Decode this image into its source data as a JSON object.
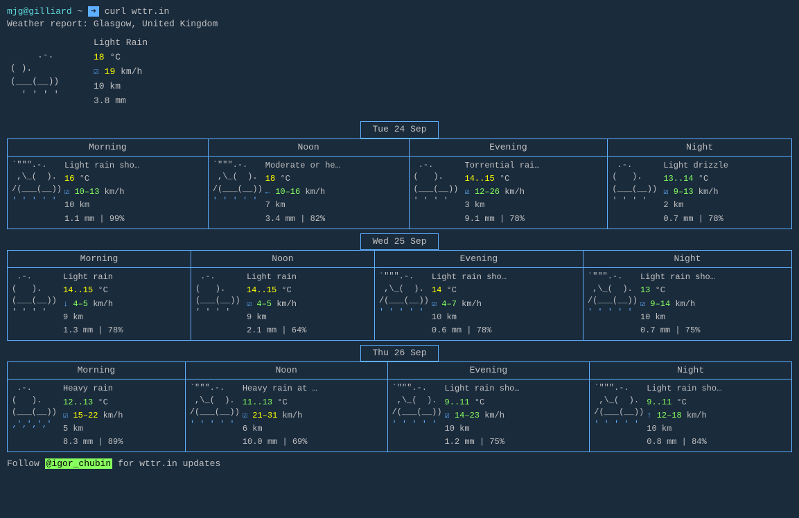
{
  "terminal": {
    "prompt": "mjg@gilliard",
    "arrow": "➜",
    "command": "curl wttr.in",
    "location_label": "Weather report: Glasgow, United Kingdom"
  },
  "current": {
    "ascii": " .-.    \n( ).    \n(___(__)  \n ' ' ' ' ",
    "description": "Light Rain",
    "temp": "18",
    "temp_unit": "°C",
    "wind_icon": "☑",
    "wind": "19",
    "wind_unit": "km/h",
    "visibility": "10 km",
    "rain": "3.8 mm"
  },
  "days": [
    {
      "label": "Tue 24 Sep",
      "periods": [
        {
          "name": "Morning",
          "ascii_lines": [
            " `\"\"\".-.  ",
            "  ,\\_(   ). ",
            " /(___(__))",
            " ' ' ' ' "
          ],
          "ascii_color": "rain",
          "desc": "Light rain sho…",
          "temp": "16",
          "temp_unit": "°C",
          "wind_icon": "☑",
          "wind_dir": "",
          "wind": "10–13",
          "wind_unit": "km/h",
          "visibility": "10 km",
          "rain": "1.1 mm",
          "prob": "99%"
        },
        {
          "name": "Noon",
          "ascii_lines": [
            " `\"\"\".-.  ",
            "  ,\\_(   ). ",
            " /(___(__))",
            " ' ' ' ' "
          ],
          "ascii_color": "rain",
          "desc": "Moderate or he…",
          "temp": "18",
          "temp_unit": "°C",
          "wind_icon": "←",
          "wind_dir": "",
          "wind": "10–16",
          "wind_unit": "km/h",
          "visibility": "7 km",
          "rain": "3.4 mm",
          "prob": "82%"
        },
        {
          "name": "Evening",
          "ascii_lines": [
            " .-.     ",
            "(   ).   ",
            "(___(__))",
            " ' ' ' ' "
          ],
          "ascii_color": "cloud",
          "desc": "Torrential rai…",
          "temp": "14..15",
          "temp_unit": "°C",
          "wind_icon": "☑",
          "wind_dir": "",
          "wind": "12–26",
          "wind_unit": "km/h",
          "visibility": "3 km",
          "rain": "9.1 mm",
          "prob": "78%"
        },
        {
          "name": "Night",
          "ascii_lines": [
            " .-.     ",
            "(   ).   ",
            "(___(__))",
            " ' ' ' ' "
          ],
          "ascii_color": "cloud",
          "desc": "Light drizzle",
          "temp": "13..14",
          "temp_unit": "°C",
          "wind_icon": "☑",
          "wind_dir": "",
          "wind": "9–13",
          "wind_unit": "km/h",
          "visibility": "2 km",
          "rain": "0.7 mm",
          "prob": "78%"
        }
      ]
    },
    {
      "label": "Wed 25 Sep",
      "periods": [
        {
          "name": "Morning",
          "ascii_lines": [
            " .-.     ",
            "(   ).   ",
            "(___(__))",
            " ' ' ' ' "
          ],
          "ascii_color": "cloud",
          "desc": "Light rain",
          "temp": "14..15",
          "temp_unit": "°C",
          "wind_icon": "↓",
          "wind_dir": "",
          "wind": "4–5",
          "wind_unit": "km/h",
          "visibility": "9 km",
          "rain": "1.3 mm",
          "prob": "78%"
        },
        {
          "name": "Noon",
          "ascii_lines": [
            " .-.     ",
            "(   ).   ",
            "(___(__))",
            " ' ' ' ' "
          ],
          "ascii_color": "cloud",
          "desc": "Light rain",
          "temp": "14..15",
          "temp_unit": "°C",
          "wind_icon": "☑",
          "wind_dir": "",
          "wind": "4–5",
          "wind_unit": "km/h",
          "visibility": "9 km",
          "rain": "2.1 mm",
          "prob": "64%"
        },
        {
          "name": "Evening",
          "ascii_lines": [
            " `\"\"\".-.  ",
            "  ,\\_(   ). ",
            " /(___(__))",
            " ' ' ' ' "
          ],
          "ascii_color": "rain",
          "desc": "Light rain sho…",
          "temp": "14",
          "temp_unit": "°C",
          "wind_icon": "☑",
          "wind_dir": "",
          "wind": "4–7",
          "wind_unit": "km/h",
          "visibility": "10 km",
          "rain": "0.6 mm",
          "prob": "78%"
        },
        {
          "name": "Night",
          "ascii_lines": [
            " `\"\"\".-.  ",
            "  ,\\_(   ). ",
            " /(___(__))",
            " ' ' ' ' "
          ],
          "ascii_color": "rain",
          "desc": "Light rain sho…",
          "temp": "13",
          "temp_unit": "°C",
          "wind_icon": "☑",
          "wind_dir": "",
          "wind": "9–14",
          "wind_unit": "km/h",
          "visibility": "10 km",
          "rain": "0.7 mm",
          "prob": "75%"
        }
      ]
    },
    {
      "label": "Thu 26 Sep",
      "periods": [
        {
          "name": "Morning",
          "ascii_lines": [
            " .-.     ",
            "(   ).   ",
            "(___(__))",
            " ' ' ' ' "
          ],
          "ascii_color": "cloud",
          "desc": "Heavy rain",
          "temp": "12..13",
          "temp_unit": "°C",
          "wind_icon": "☑",
          "wind_dir": "",
          "wind": "15–22",
          "wind_unit": "km/h",
          "visibility": "5 km",
          "rain": "8.3 mm",
          "prob": "89%"
        },
        {
          "name": "Noon",
          "ascii_lines": [
            " `\"\"\".-.  ",
            "  ,\\_(   ). ",
            " /(___(__))",
            " ' ' ' ' "
          ],
          "ascii_color": "rain",
          "desc": "Heavy rain at …",
          "temp": "11..13",
          "temp_unit": "°C",
          "wind_icon": "☑",
          "wind_dir": "",
          "wind": "21–31",
          "wind_unit": "km/h",
          "visibility": "6 km",
          "rain": "10.0 mm",
          "prob": "69%"
        },
        {
          "name": "Evening",
          "ascii_lines": [
            " `\"\"\".-.  ",
            "  ,\\_(   ). ",
            " /(___(__))",
            " ' ' ' ' "
          ],
          "ascii_color": "rain",
          "desc": "Light rain sho…",
          "temp": "9..11",
          "temp_unit": "°C",
          "wind_icon": "☑",
          "wind_dir": "",
          "wind": "14–23",
          "wind_unit": "km/h",
          "visibility": "10 km",
          "rain": "1.2 mm",
          "prob": "75%"
        },
        {
          "name": "Night",
          "ascii_lines": [
            " `\"\"\".-.  ",
            "  ,\\_(   ). ",
            " /(___(__))",
            " ' ' ' ' "
          ],
          "ascii_color": "rain",
          "desc": "Light rain sho…",
          "temp": "9..11",
          "temp_unit": "°C",
          "wind_icon": "↑",
          "wind_dir": "",
          "wind": "12–18",
          "wind_unit": "km/h",
          "visibility": "10 km",
          "rain": "0.8 mm",
          "prob": "84%"
        }
      ]
    }
  ],
  "footer": {
    "text_before": "Follow ",
    "link": "@igor_chubin",
    "text_after": " for wttr.in updates"
  }
}
